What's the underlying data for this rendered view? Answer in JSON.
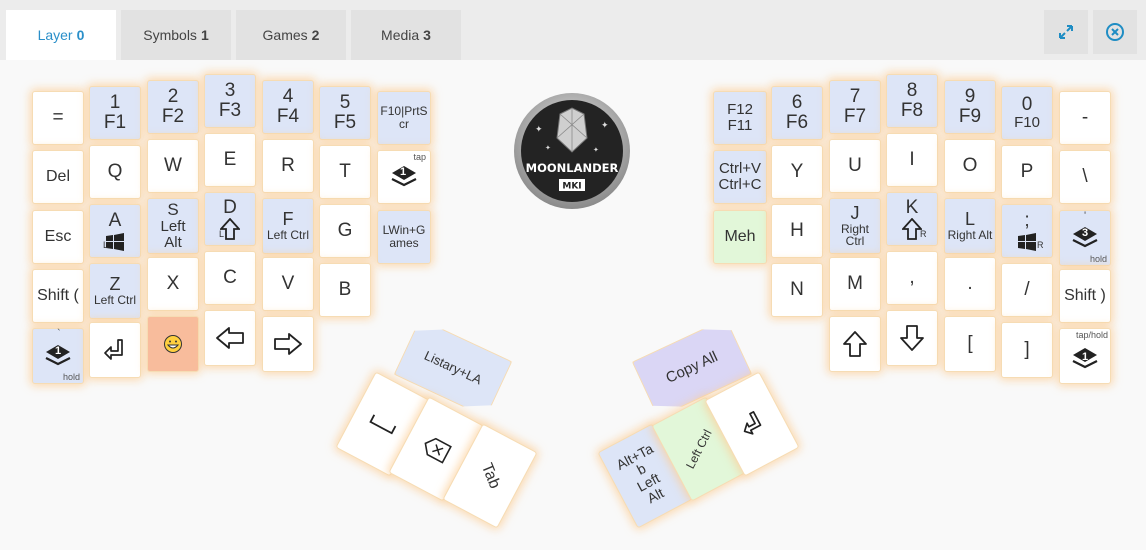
{
  "tabs": [
    {
      "label": "Layer",
      "num": "0"
    },
    {
      "label": "Symbols",
      "num": "1"
    },
    {
      "label": "Games",
      "num": "2"
    },
    {
      "label": "Media",
      "num": "3"
    }
  ],
  "logo": {
    "line1": "MOONLANDER",
    "line2": "MKI"
  },
  "left": {
    "eq": "=",
    "f1": {
      "a": "1",
      "b": "F1"
    },
    "f2": {
      "a": "2",
      "b": "F2"
    },
    "f3": {
      "a": "3",
      "b": "F3"
    },
    "f4": {
      "a": "4",
      "b": "F4"
    },
    "f5": {
      "a": "5",
      "b": "F5"
    },
    "f10": {
      "a": "F10|PrtS",
      "b": "cr"
    },
    "del": "Del",
    "q": "Q",
    "w": "W",
    "e": "E",
    "r": "R",
    "t": "T",
    "tap": "tap",
    "layer1": "1",
    "esc": "Esc",
    "a": {
      "a": "A",
      "mod": "L"
    },
    "s": {
      "a": "S",
      "b": "Left",
      "c": "Alt"
    },
    "d": {
      "a": "D",
      "mod": "L"
    },
    "f": {
      "a": "F",
      "b": "Left Ctrl"
    },
    "g": "G",
    "lwin": {
      "a": "LWin+G",
      "b": "ames"
    },
    "shift": "Shift (",
    "z": {
      "a": "Z",
      "b": "Left Ctrl"
    },
    "x": "X",
    "c": "C",
    "v": "V",
    "b": "B",
    "grave": "`",
    "hold": "hold"
  },
  "right": {
    "f12": {
      "a": "F12",
      "b": "F11"
    },
    "f6": {
      "a": "6",
      "b": "F6"
    },
    "f7": {
      "a": "7",
      "b": "F7"
    },
    "f8": {
      "a": "8",
      "b": "F8"
    },
    "f9": {
      "a": "9",
      "b": "F9"
    },
    "f0": {
      "a": "0",
      "b": "F10"
    },
    "minus": "-",
    "ctrlv": {
      "a": "Ctrl+V",
      "b": "Ctrl+C"
    },
    "y": "Y",
    "u": "U",
    "i": "I",
    "o": "O",
    "p": "P",
    "bslash": "\\",
    "meh": "Meh",
    "h": "H",
    "j": {
      "a": "J",
      "b": "Right",
      "c": "Ctrl"
    },
    "k": {
      "a": "K",
      "mod": "R"
    },
    "l": {
      "a": "L",
      "b": "Right Alt"
    },
    "semi": {
      "a": ";",
      "mod": "R"
    },
    "quote": "'",
    "layer3": "3",
    "hold": "hold",
    "n": "N",
    "m": "M",
    "comma": ",",
    "period": ".",
    "slash": "/",
    "shift": "Shift )",
    "lbr": "[",
    "rbr": "]",
    "taphold": "tap/hold",
    "layer1": "1"
  },
  "thumbs": {
    "listary": "Listary+LA",
    "tab": "Tab",
    "copyall": "Copy All",
    "lctrl": "Left Ctrl",
    "alttab": {
      "a": "Alt+Ta",
      "b": "b",
      "c": "Left",
      "d": "Alt"
    }
  },
  "colors": {
    "accent": "#2a8fc9",
    "blue": "#dde5f7",
    "green": "#e2f7d9",
    "orange": "#f8bc9c",
    "purple": "#dad6f5",
    "glow": "#fcd296"
  }
}
